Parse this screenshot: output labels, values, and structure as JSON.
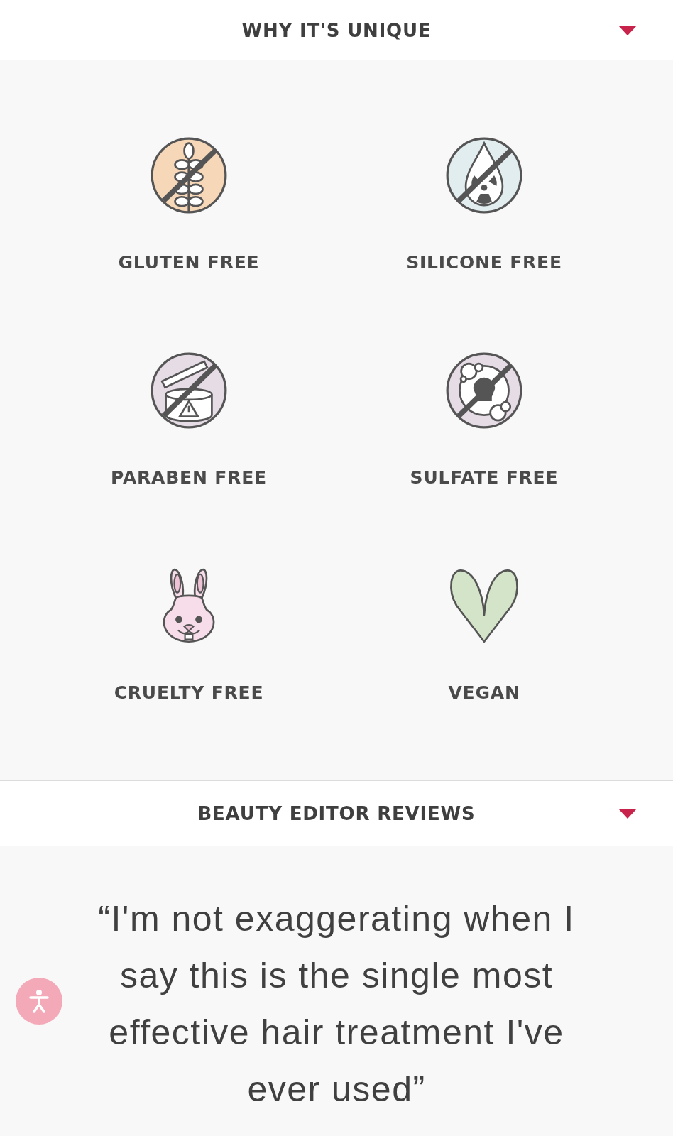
{
  "sections": [
    {
      "title": "WHY IT'S UNIQUE"
    },
    {
      "title": "BEAUTY EDITOR REVIEWS"
    }
  ],
  "features": [
    {
      "label": "GLUTEN FREE",
      "kind": "gluten"
    },
    {
      "label": "SILICONE FREE",
      "kind": "silicone"
    },
    {
      "label": "PARABEN FREE",
      "kind": "paraben"
    },
    {
      "label": "SULFATE FREE",
      "kind": "sulfate"
    },
    {
      "label": "CRUELTY FREE",
      "kind": "cruelty"
    },
    {
      "label": "VEGAN",
      "kind": "vegan"
    }
  ],
  "quote": "“I'm not exaggerating when I say this is the single most effective hair treatment I've ever used”"
}
